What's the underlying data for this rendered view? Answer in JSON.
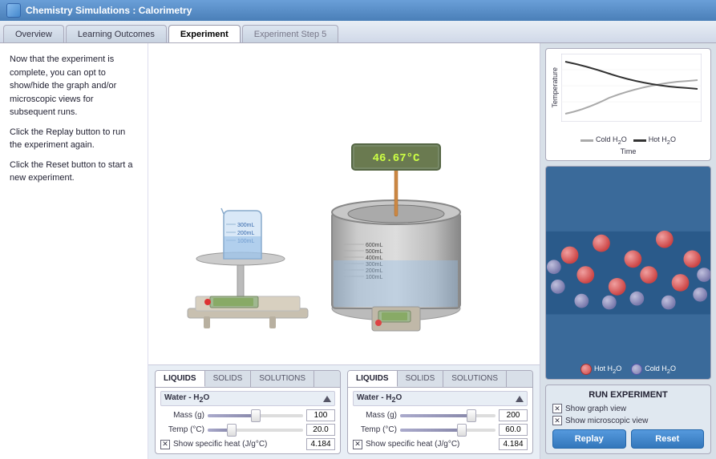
{
  "titleBar": {
    "title": "Chemistry Simulations : Calorimetry"
  },
  "tabs": [
    {
      "id": "overview",
      "label": "Overview",
      "active": false
    },
    {
      "id": "outcomes",
      "label": "Learning Outcomes",
      "active": false
    },
    {
      "id": "experiment",
      "label": "Experiment",
      "active": true
    },
    {
      "id": "step5",
      "label": "Experiment Step 5",
      "active": false,
      "inactive": true
    }
  ],
  "leftPanel": {
    "lines": [
      "Now that the experiment is complete, you can opt to show/hide the graph and/or microscopic views for subsequent runs.",
      "Click the Replay button to run the experiment again.",
      "Click the Reset button to start a new experiment."
    ]
  },
  "temperature": "46.67°C",
  "leftSubstance": {
    "tabs": [
      "LIQUIDS",
      "SOLIDS",
      "SOLUTIONS"
    ],
    "activeTab": "LIQUIDS",
    "name": "Water - H₂O",
    "massLabel": "Mass (g)",
    "massValue": "100",
    "massFillPct": 50,
    "tempLabel": "Temp (°C)",
    "tempValue": "20.0",
    "tempFillPct": 25,
    "showSpecificHeat": "Show specific heat (J/g°C)",
    "specificHeatValue": "4.184"
  },
  "rightSubstance": {
    "tabs": [
      "LIQUIDS",
      "SOLIDS",
      "SOLUTIONS"
    ],
    "activeTab": "LIQUIDS",
    "name": "Water - H₂O",
    "massLabel": "Mass (g)",
    "massValue": "200",
    "massFillPct": 75,
    "tempLabel": "Temp (°C)",
    "tempValue": "60.0",
    "tempFillPct": 65,
    "showSpecificHeat": "Show specific heat (J/g°C)",
    "specificHeatValue": "4.184"
  },
  "graph": {
    "yLabel": "Temperature",
    "xLabel": "Time",
    "legend": [
      {
        "label": "Cold H₂O",
        "color": "#aaaaaa"
      },
      {
        "label": "Hot H₂O",
        "color": "#222222"
      }
    ]
  },
  "microscopicLegend": [
    {
      "label": "Hot H₂O",
      "color": "#e06060"
    },
    {
      "label": "Cold H₂O",
      "color": "#aaaacc"
    }
  ],
  "runExperiment": {
    "title": "RUN EXPERIMENT",
    "showGraphView": "Show graph view",
    "showMicroscopicView": "Show microscopic view",
    "replayLabel": "Replay",
    "resetLabel": "Reset"
  }
}
